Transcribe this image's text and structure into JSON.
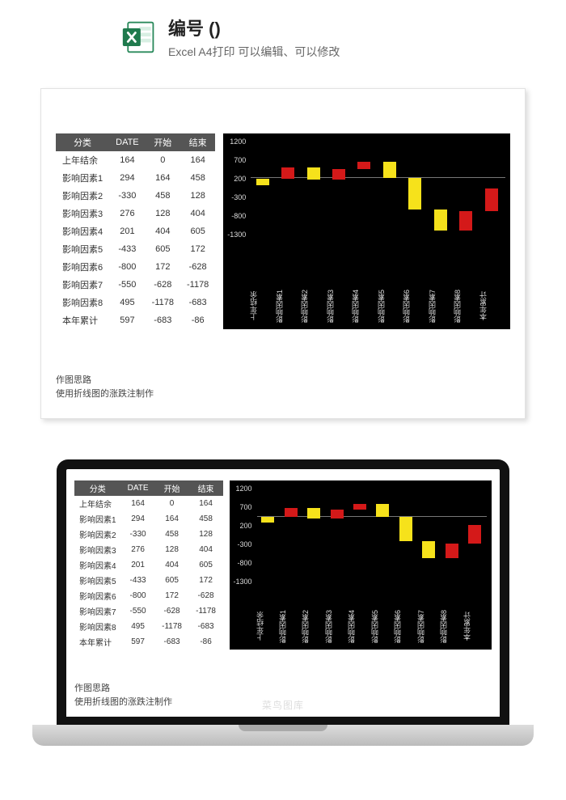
{
  "header": {
    "title": "编号 ()",
    "subtitle": "Excel A4打印 可以编辑、可以修改"
  },
  "table": {
    "headers": [
      "分类",
      "DATE",
      "开始",
      "结束"
    ],
    "rows": [
      [
        "上年结余",
        "164",
        "0",
        "164"
      ],
      [
        "影响因素1",
        "294",
        "164",
        "458"
      ],
      [
        "影响因素2",
        "-330",
        "458",
        "128"
      ],
      [
        "影响因素3",
        "276",
        "128",
        "404"
      ],
      [
        "影响因素4",
        "201",
        "404",
        "605"
      ],
      [
        "影响因素5",
        "-433",
        "605",
        "172"
      ],
      [
        "影响因素6",
        "-800",
        "172",
        "-628"
      ],
      [
        "影响因素7",
        "-550",
        "-628",
        "-1178"
      ],
      [
        "影响因素8",
        "495",
        "-1178",
        "-683"
      ],
      [
        "本年累计",
        "597",
        "-683",
        "-86"
      ]
    ]
  },
  "notes": {
    "line1": "作图思路",
    "line2": "使用折线图的涨跌注制作"
  },
  "laptop_brand": "菜鸟图库",
  "chart_data": {
    "type": "bar",
    "title": "",
    "xlabel": "",
    "ylabel": "",
    "ylim": [
      -1300,
      1200
    ],
    "yticks": [
      1200,
      700,
      200,
      -300,
      -800,
      -1300
    ],
    "categories": [
      "上年结余",
      "影响因素1",
      "影响因素2",
      "影响因素3",
      "影响因素4",
      "影响因素5",
      "影响因素6",
      "影响因素7",
      "影响因素8",
      "本年累计"
    ],
    "series": [
      {
        "name": "开始",
        "values": [
          0,
          164,
          458,
          128,
          404,
          605,
          172,
          -628,
          -1178,
          -683
        ]
      },
      {
        "name": "结束",
        "values": [
          164,
          458,
          128,
          404,
          605,
          172,
          -628,
          -1178,
          -683,
          -86
        ]
      }
    ],
    "direction": [
      "down",
      "up",
      "down",
      "up",
      "up",
      "down",
      "down",
      "down",
      "up",
      "up"
    ]
  }
}
